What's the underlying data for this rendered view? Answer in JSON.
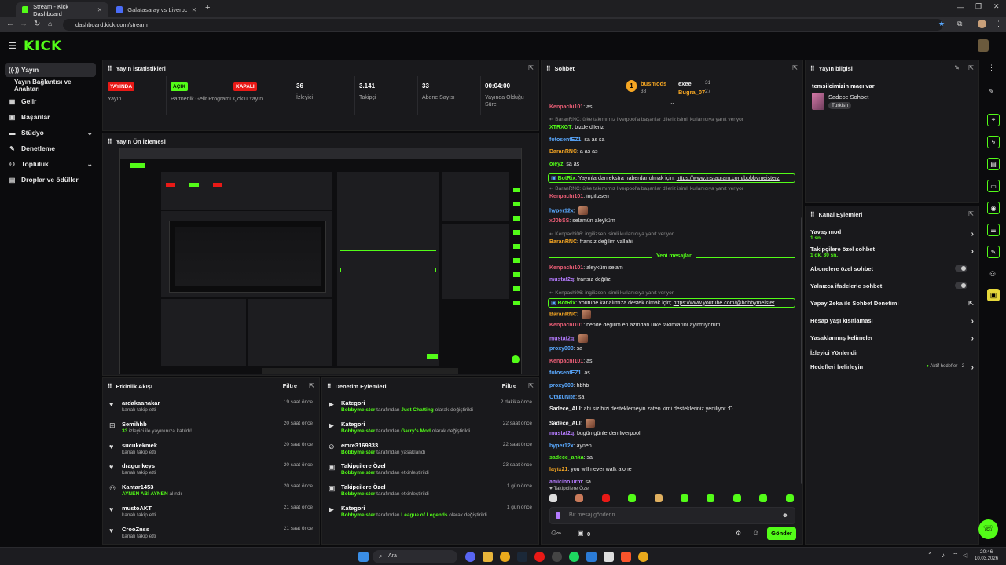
{
  "browser": {
    "tabs": [
      {
        "title": "Stream - Kick Dashboard"
      },
      {
        "title": "Galatasaray vs Liverpool live sc"
      }
    ],
    "url": "dashboard.kick.com/stream"
  },
  "header": {
    "logo": "KICK"
  },
  "sidebar": {
    "items": [
      {
        "label": "Yayın",
        "icon": "broadcast-icon"
      },
      {
        "label": "Yayın Bağlantısı ve Anahtarı",
        "icon": ""
      },
      {
        "label": "Gelir",
        "icon": "revenue-icon"
      },
      {
        "label": "Başarılar",
        "icon": "achievements-icon"
      },
      {
        "label": "Stüdyo",
        "icon": "studio-icon"
      },
      {
        "label": "Denetleme",
        "icon": "moderation-icon"
      },
      {
        "label": "Topluluk",
        "icon": "community-icon"
      },
      {
        "label": "Droplar ve ödüller",
        "icon": "drops-icon"
      }
    ]
  },
  "stats": {
    "title": "Yayın İstatistikleri",
    "items": [
      {
        "badge": "YAYINDA",
        "label": "Yayın"
      },
      {
        "badge": "AÇIK",
        "label": "Partnerlik Gelir Programı"
      },
      {
        "badge": "KAPALI",
        "label": "Çoklu Yayın"
      },
      {
        "value": "36",
        "label": "İzleyici"
      },
      {
        "value": "3.141",
        "label": "Takipçi"
      },
      {
        "value": "33",
        "label": "Abone Sayısı"
      },
      {
        "value": "00:04:00",
        "label": "Yayında Olduğu Süre"
      }
    ]
  },
  "preview": {
    "title": "Yayın Ön İzlemesi"
  },
  "activity": {
    "title": "Etkinlik Akışı",
    "filter": "Filtre",
    "rows": [
      {
        "name": "ardakaanakar",
        "sub": "kanalı takip etti",
        "time": "19 saat önce"
      },
      {
        "name": "Semihhb",
        "sub_green": "33",
        "sub": " izleyici ile yayınınıza katıldı!",
        "time": "20 saat önce"
      },
      {
        "name": "sucukekmek",
        "sub": "kanalı takip etti",
        "time": "20 saat önce"
      },
      {
        "name": "dragonkeys",
        "sub": "kanalı takip etti",
        "time": "20 saat önce"
      },
      {
        "name": "Kantar1453",
        "sub_green": "AYNEN ABİ AYNEN",
        "sub": " alındı",
        "time": "20 saat önce"
      },
      {
        "name": "mustoAKT",
        "sub": "kanalı takip etti",
        "time": "21 saat önce"
      },
      {
        "name": "CrooZnss",
        "sub": "kanalı takip etti",
        "time": "21 saat önce"
      }
    ]
  },
  "modlog": {
    "title": "Denetim Eylemleri",
    "filter": "Filtre",
    "rows": [
      {
        "name": "Kategori",
        "actor": "Bobbymeister",
        "mid": " tarafından ",
        "target": "Just Chatting",
        "tail": " olarak değiştirildi",
        "time": "2 dakika önce"
      },
      {
        "name": "Kategori",
        "actor": "Bobbymeister",
        "mid": " tarafından ",
        "target": "Garry's Mod",
        "tail": " olarak değiştirildi",
        "time": "22 saat önce"
      },
      {
        "name": "emre3169333",
        "actor": "Bobbymeister",
        "mid": " tarafından yasaklandı",
        "target": "",
        "tail": "",
        "time": "22 saat önce"
      },
      {
        "name": "Takipçilere Özel",
        "actor": "Bobbymeister",
        "mid": " tarafından etkinleştirildi",
        "target": "",
        "tail": "",
        "time": "23 saat önce"
      },
      {
        "name": "Takipçilere Özel",
        "actor": "Bobbymeister",
        "mid": " tarafından etkinleştirildi",
        "target": "",
        "tail": "",
        "time": "1 gün önce"
      },
      {
        "name": "Kategori",
        "actor": "Bobbymeister",
        "mid": " tarafından ",
        "target": "League of Legends",
        "tail": " olarak değiştirildi",
        "time": "1 gün önce"
      }
    ]
  },
  "chat": {
    "title": "Sohbet",
    "leaders": [
      {
        "name": "busmods",
        "count": "38",
        "color": "#f5a623"
      },
      {
        "name": "exee",
        "count": "31",
        "color": "#eeeeee"
      },
      {
        "name": "Bugra_07",
        "count": "27",
        "color": "#f5a623"
      }
    ],
    "messages": [
      {
        "user": "Kenpachi101",
        "color": "#e85d75",
        "text": "as"
      },
      {
        "reply": "BaranRNC: ülke takımımız liverpool'a başarılar dileriz isimli kullanıcıya yanıt veriyor"
      },
      {
        "user": "XTRXGT",
        "color": "#53fc18",
        "text": "bizde dileriz"
      },
      {
        "user": "fotosentEZ1",
        "color": "#5aa9ff",
        "text": "sa as sa"
      },
      {
        "user": "BaranRNC",
        "color": "#f5a623",
        "text": "a as as"
      },
      {
        "user": "oleyz",
        "color": "#53fc18",
        "text": "sa as"
      },
      {
        "user": "BotRix",
        "color": "#53fc18",
        "text": "Yayınlardan ekstra haberdar olmak için; ",
        "link": "https://www.instagram.com/bobbymeisterz"
      },
      {
        "reply": "BaranRNC: ülke takımımız liverpool'a başarılar dileriz isimli kullanıcıya yanıt veriyor"
      },
      {
        "user": "Kenpachi101",
        "color": "#e85d75",
        "text": "ingilizsen"
      },
      {
        "user": "hyper12x",
        "color": "#5aa9ff",
        "text": ""
      },
      {
        "user": "xJ0bSS",
        "color": "#e85d75",
        "text": "selamün aleyküm"
      },
      {
        "reply": "Kenpachi06: ingilizsen isimli kullanıcıya yanıt veriyor"
      },
      {
        "user": "BaranRNC",
        "color": "#f5a623",
        "text": "fransız değilim vallahi"
      }
    ],
    "new_messages": "Yeni mesajlar",
    "messages2": [
      {
        "user": "Kenpachi101",
        "color": "#e85d75",
        "text": "aleyküm selam"
      },
      {
        "user": "mustaf2q",
        "color": "#b57bff",
        "text": "fransız değiliz"
      },
      {
        "reply": "Kenpachi06: ingilizsen isimli kullanıcıya yanıt veriyor"
      },
      {
        "user": "BotRix",
        "color": "#53fc18",
        "text": "Youtube kanalımıza destek olmak için; ",
        "link": "https://www.youtube.com/@bobbymeister"
      },
      {
        "user": "BaranRNC",
        "color": "#f5a623",
        "text": ""
      },
      {
        "user": "Kenpachi101",
        "color": "#e85d75",
        "text": "bende değilim en azından ülke takımlarını ayırmıyorum."
      },
      {
        "user": "mustaf2q",
        "color": "#b57bff",
        "text": ""
      },
      {
        "user": "proxy000",
        "color": "#5aa9ff",
        "text": "sa"
      },
      {
        "user": "Kenpachi101",
        "color": "#e85d75",
        "text": "as"
      },
      {
        "user": "fotosentEZ1",
        "color": "#5aa9ff",
        "text": "as"
      },
      {
        "user": "proxy000",
        "color": "#5aa9ff",
        "text": "hbhb"
      },
      {
        "user": "OtakuNite",
        "color": "#5aa9ff",
        "text": "sa"
      },
      {
        "user": "Sadece_ALI",
        "color": "#eeeeee",
        "text": "abi siz bizi desteklemeyin zaten kimi destekleriniz yeniliyor :D"
      },
      {
        "user": "Sadece_ALI",
        "color": "#eeeeee",
        "text": ""
      },
      {
        "user": "mustaf2q",
        "color": "#b57bff",
        "text": "bugün günlerden liverpool"
      },
      {
        "user": "hyper12x",
        "color": "#5aa9ff",
        "text": "aynen"
      },
      {
        "user": "sadece_anka",
        "color": "#53fc18",
        "text": "sa"
      },
      {
        "user": "layix21",
        "color": "#f5a623",
        "text": "you will never walk alone"
      },
      {
        "user": "amicinolurm",
        "color": "#b57bff",
        "text": "sa"
      }
    ],
    "followers_only": "Takipçilere Özel",
    "input_placeholder": "Bir mesaj gönderin",
    "count": "0",
    "send": "Gönder"
  },
  "stream_info": {
    "title": "Yayın bilgisi",
    "stream_title": "temsilcimizin maçı var",
    "category": "Sadece Sohbet",
    "tag": "Turkish"
  },
  "channel_actions": {
    "title": "Kanal Eylemleri",
    "items": [
      {
        "label": "Yavaş mod",
        "sub": "1 sn."
      },
      {
        "label": "Takipçilere özel sohbet",
        "sub": "1 dk. 30 sn."
      },
      {
        "label": "Abonelere özel sohbet"
      },
      {
        "label": "Yalnızca ifadelerle sohbet"
      },
      {
        "label": "Yapay Zeka ile Sohbet Denetimi"
      },
      {
        "label": "Hesap yaşı kısıtlaması"
      },
      {
        "label": "Yasaklanmış kelimeler"
      },
      {
        "label": "İzleyici Yönlendir"
      },
      {
        "label": "Hedefleri belirleyin",
        "right": "Aktif hedefler - 2"
      }
    ]
  },
  "taskbar": {
    "search": "Ara",
    "time": "20:46",
    "date": "10.03.2026"
  },
  "colors": {
    "accent": "#53fc18",
    "live": "#e91916",
    "panel": "#19191c"
  }
}
